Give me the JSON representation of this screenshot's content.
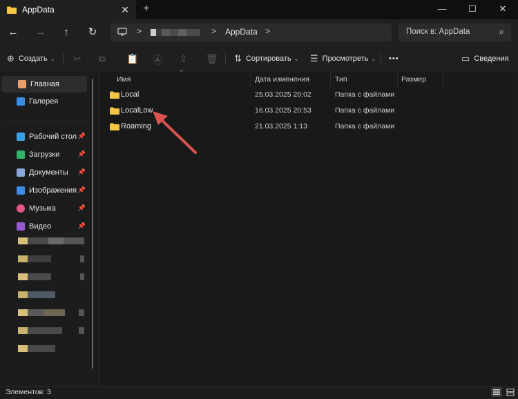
{
  "window": {
    "tab_title": "AppData",
    "tab_close": "✕",
    "new_tab": "+",
    "minimize": "—",
    "maximize": "☐",
    "close": "✕"
  },
  "nav": {
    "back": "←",
    "forward": "→",
    "up": "↑",
    "refresh": "↻",
    "separator": ">",
    "breadcrumb_current": "AppData",
    "search_placeholder": "Поиск в: AppData",
    "search_icon": "⌕"
  },
  "toolbar": {
    "create_label": "Создать",
    "sort_label": "Сортировать",
    "view_label": "Просмотреть",
    "more_label": "•••",
    "details_label": "Сведения",
    "icons": [
      "cut-icon",
      "copy-icon",
      "paste-icon",
      "rename-icon",
      "share-icon",
      "delete-icon"
    ]
  },
  "sidebar": {
    "items": [
      {
        "label": "Главная",
        "icon": "home-icon",
        "color": "#e8a06a"
      },
      {
        "label": "Галерея",
        "icon": "gallery-icon",
        "color": "#3a8ee6"
      }
    ],
    "pinned": [
      {
        "label": "Рабочий стол",
        "icon": "desktop-icon",
        "color": "#3aa0e6"
      },
      {
        "label": "Загрузки",
        "icon": "downloads-icon",
        "color": "#2fb36b"
      },
      {
        "label": "Документы",
        "icon": "documents-icon",
        "color": "#8aa6d6"
      },
      {
        "label": "Изображения",
        "icon": "pictures-icon",
        "color": "#3a8ee6"
      },
      {
        "label": "Музыка",
        "icon": "music-icon",
        "color": "#e6558a"
      },
      {
        "label": "Видео",
        "icon": "videos-icon",
        "color": "#9b59d6"
      }
    ],
    "pin_glyph": "📌"
  },
  "columns": {
    "name": "Имя",
    "date": "Дата изменения",
    "type": "Тип",
    "size": "Размер"
  },
  "files": [
    {
      "name": "Local",
      "date": "25.03.2025 20:02",
      "type": "Папка с файлами"
    },
    {
      "name": "LocalLow",
      "date": "16.03.2025 20:53",
      "type": "Папка с файлами"
    },
    {
      "name": "Roaming",
      "date": "21.03.2025 1:13",
      "type": "Папка с файлами"
    }
  ],
  "status": {
    "count": "Элементов: 3"
  },
  "colors": {
    "folder": "#f4c542",
    "accent_arrow": "#d9534f"
  }
}
